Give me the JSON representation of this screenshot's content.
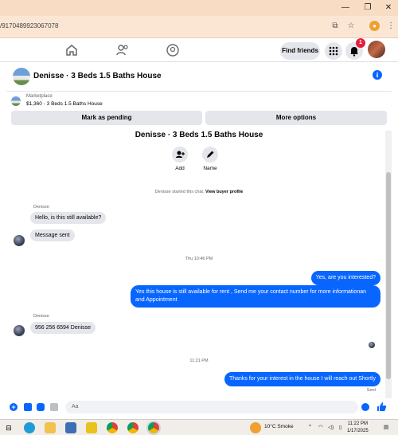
{
  "browser": {
    "url": "/9170489923067078",
    "colors": {
      "titlebar": "#f8dcc3",
      "addressbar": "#fbe6d4"
    }
  },
  "fb_nav": {
    "find_friends_label": "Find friends",
    "notification_count": "1",
    "icons": [
      "home-icon",
      "friends-icon",
      "groups-icon",
      "menu-grid-icon",
      "bell-icon"
    ]
  },
  "chat_header": {
    "title": "Denisse · 3 Beds 1.5 Baths House",
    "info_glyph": "i"
  },
  "marketplace": {
    "label": "Marketplace",
    "item": "$1,360 - 3 Beds 1.5 Baths House",
    "mark_pending_label": "Mark as pending",
    "more_options_label": "More options"
  },
  "conversation": {
    "title": "Denisse · 3 Beds 1.5 Baths House",
    "add_label": "Add",
    "name_label": "Name",
    "started_text": "Denisse started this chat.",
    "view_profile_label": "View buyer profile",
    "sender_name_1": "Denisse",
    "msg_in_1": "Hello, is this still available?",
    "msg_in_2": "Message sent",
    "timestamp_1": "Thu 10:46 PM",
    "msg_out_1": "Yes, are you interested?",
    "msg_out_2": "Yes this house is still available for rent , Send me your contact number for more informationan and Appointment",
    "sender_name_2": "Denisse",
    "msg_in_3": "956 256 6594 Denisse",
    "timestamp_2": "11:21 PM",
    "msg_out_3": "Thanks for your interest in the house I will reach out Shortly",
    "sent_status": "Sent"
  },
  "composer": {
    "placeholder": "Aa"
  },
  "taskbar": {
    "weather": "10°C  Smoke",
    "time": "11:22 PM",
    "date": "1/17/2025"
  },
  "accent_color": "#0866ff"
}
